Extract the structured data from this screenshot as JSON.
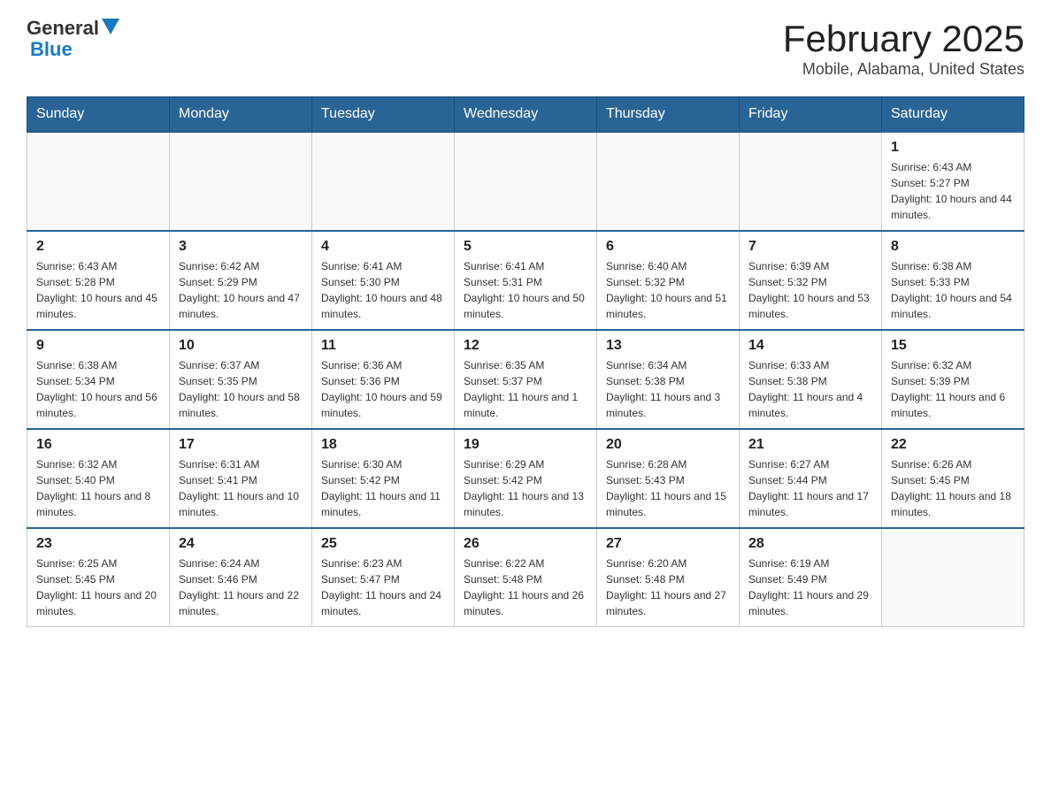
{
  "logo": {
    "general": "General",
    "blue": "Blue"
  },
  "header": {
    "month": "February 2025",
    "location": "Mobile, Alabama, United States"
  },
  "weekdays": [
    "Sunday",
    "Monday",
    "Tuesday",
    "Wednesday",
    "Thursday",
    "Friday",
    "Saturday"
  ],
  "weeks": [
    [
      {
        "day": "",
        "info": ""
      },
      {
        "day": "",
        "info": ""
      },
      {
        "day": "",
        "info": ""
      },
      {
        "day": "",
        "info": ""
      },
      {
        "day": "",
        "info": ""
      },
      {
        "day": "",
        "info": ""
      },
      {
        "day": "1",
        "info": "Sunrise: 6:43 AM\nSunset: 5:27 PM\nDaylight: 10 hours and 44 minutes."
      }
    ],
    [
      {
        "day": "2",
        "info": "Sunrise: 6:43 AM\nSunset: 5:28 PM\nDaylight: 10 hours and 45 minutes."
      },
      {
        "day": "3",
        "info": "Sunrise: 6:42 AM\nSunset: 5:29 PM\nDaylight: 10 hours and 47 minutes."
      },
      {
        "day": "4",
        "info": "Sunrise: 6:41 AM\nSunset: 5:30 PM\nDaylight: 10 hours and 48 minutes."
      },
      {
        "day": "5",
        "info": "Sunrise: 6:41 AM\nSunset: 5:31 PM\nDaylight: 10 hours and 50 minutes."
      },
      {
        "day": "6",
        "info": "Sunrise: 6:40 AM\nSunset: 5:32 PM\nDaylight: 10 hours and 51 minutes."
      },
      {
        "day": "7",
        "info": "Sunrise: 6:39 AM\nSunset: 5:32 PM\nDaylight: 10 hours and 53 minutes."
      },
      {
        "day": "8",
        "info": "Sunrise: 6:38 AM\nSunset: 5:33 PM\nDaylight: 10 hours and 54 minutes."
      }
    ],
    [
      {
        "day": "9",
        "info": "Sunrise: 6:38 AM\nSunset: 5:34 PM\nDaylight: 10 hours and 56 minutes."
      },
      {
        "day": "10",
        "info": "Sunrise: 6:37 AM\nSunset: 5:35 PM\nDaylight: 10 hours and 58 minutes."
      },
      {
        "day": "11",
        "info": "Sunrise: 6:36 AM\nSunset: 5:36 PM\nDaylight: 10 hours and 59 minutes."
      },
      {
        "day": "12",
        "info": "Sunrise: 6:35 AM\nSunset: 5:37 PM\nDaylight: 11 hours and 1 minute."
      },
      {
        "day": "13",
        "info": "Sunrise: 6:34 AM\nSunset: 5:38 PM\nDaylight: 11 hours and 3 minutes."
      },
      {
        "day": "14",
        "info": "Sunrise: 6:33 AM\nSunset: 5:38 PM\nDaylight: 11 hours and 4 minutes."
      },
      {
        "day": "15",
        "info": "Sunrise: 6:32 AM\nSunset: 5:39 PM\nDaylight: 11 hours and 6 minutes."
      }
    ],
    [
      {
        "day": "16",
        "info": "Sunrise: 6:32 AM\nSunset: 5:40 PM\nDaylight: 11 hours and 8 minutes."
      },
      {
        "day": "17",
        "info": "Sunrise: 6:31 AM\nSunset: 5:41 PM\nDaylight: 11 hours and 10 minutes."
      },
      {
        "day": "18",
        "info": "Sunrise: 6:30 AM\nSunset: 5:42 PM\nDaylight: 11 hours and 11 minutes."
      },
      {
        "day": "19",
        "info": "Sunrise: 6:29 AM\nSunset: 5:42 PM\nDaylight: 11 hours and 13 minutes."
      },
      {
        "day": "20",
        "info": "Sunrise: 6:28 AM\nSunset: 5:43 PM\nDaylight: 11 hours and 15 minutes."
      },
      {
        "day": "21",
        "info": "Sunrise: 6:27 AM\nSunset: 5:44 PM\nDaylight: 11 hours and 17 minutes."
      },
      {
        "day": "22",
        "info": "Sunrise: 6:26 AM\nSunset: 5:45 PM\nDaylight: 11 hours and 18 minutes."
      }
    ],
    [
      {
        "day": "23",
        "info": "Sunrise: 6:25 AM\nSunset: 5:45 PM\nDaylight: 11 hours and 20 minutes."
      },
      {
        "day": "24",
        "info": "Sunrise: 6:24 AM\nSunset: 5:46 PM\nDaylight: 11 hours and 22 minutes."
      },
      {
        "day": "25",
        "info": "Sunrise: 6:23 AM\nSunset: 5:47 PM\nDaylight: 11 hours and 24 minutes."
      },
      {
        "day": "26",
        "info": "Sunrise: 6:22 AM\nSunset: 5:48 PM\nDaylight: 11 hours and 26 minutes."
      },
      {
        "day": "27",
        "info": "Sunrise: 6:20 AM\nSunset: 5:48 PM\nDaylight: 11 hours and 27 minutes."
      },
      {
        "day": "28",
        "info": "Sunrise: 6:19 AM\nSunset: 5:49 PM\nDaylight: 11 hours and 29 minutes."
      },
      {
        "day": "",
        "info": ""
      }
    ]
  ]
}
